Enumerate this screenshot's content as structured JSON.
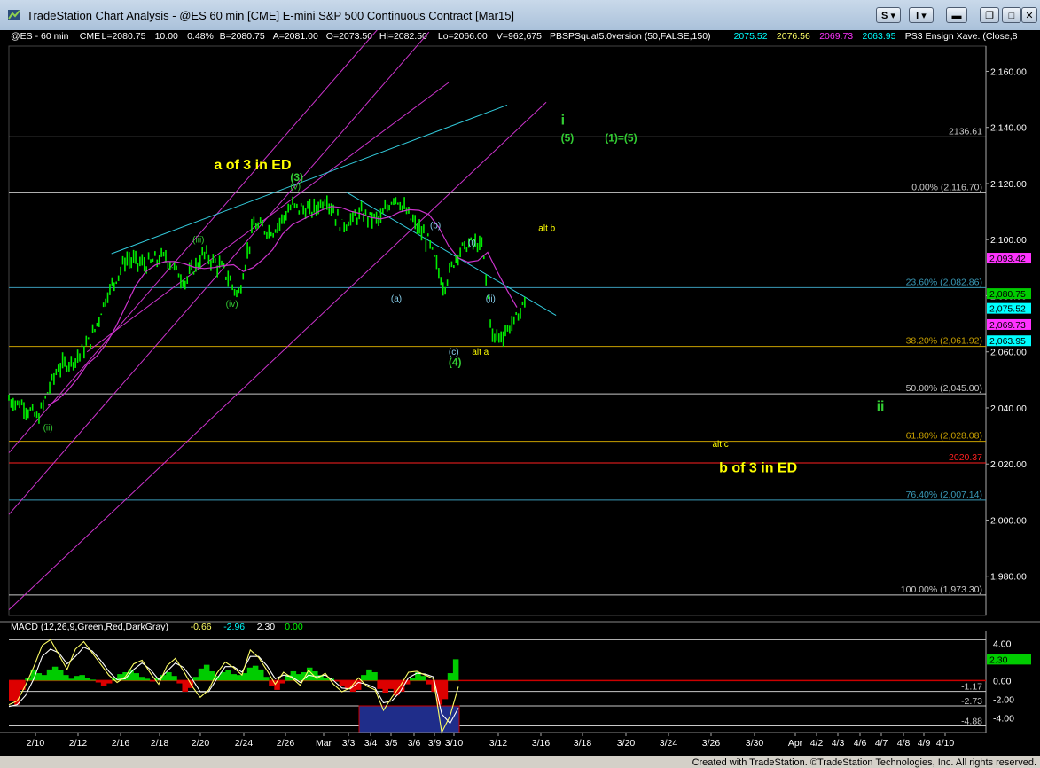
{
  "window": {
    "title": "TradeStation Chart Analysis - @ES 60 min [CME] E-mini S&P 500 Continuous Contract [Mar15]",
    "btn_s": "S",
    "btn_i": "I",
    "icons": [
      "minimize-small-icon",
      "restore-icon",
      "maximize-icon",
      "close-icon"
    ]
  },
  "footer": "Created with TradeStation. ©TradeStation Technologies, Inc. All rights reserved.",
  "chart_data": [
    {
      "type": "line",
      "subtype": "candlestick-price",
      "symbol_line": [
        {
          "text": "@ES - 60 min",
          "color": "#ffffff"
        },
        {
          "text": "CME",
          "color": "#ffffff"
        },
        {
          "text": "L=2080.75",
          "color": "#ffffff"
        },
        {
          "text": "10.00",
          "color": "#ffffff"
        },
        {
          "text": "0.48%",
          "color": "#ffffff"
        },
        {
          "text": "B=2080.75",
          "color": "#ffffff"
        },
        {
          "text": "A=2081.00",
          "color": "#ffffff"
        },
        {
          "text": "O=2073.50",
          "color": "#ffffff"
        },
        {
          "text": "Hi=2082.50",
          "color": "#ffffff"
        },
        {
          "text": "Lo=2066.00",
          "color": "#ffffff"
        },
        {
          "text": "V=962,675",
          "color": "#ffffff"
        },
        {
          "text": "PBSPSquat5.0version (50,FALSE,150)",
          "color": "#ffffff"
        },
        {
          "text": "2075.52",
          "color": "#00ffff"
        },
        {
          "text": "2076.56",
          "color": "#ffff66"
        },
        {
          "text": "2069.73",
          "color": "#ff33ff"
        },
        {
          "text": "2063.95",
          "color": "#00ffff"
        },
        {
          "text": "PS3 Ensign Xave. (Close,8",
          "color": "#ffffff"
        }
      ],
      "y_axis": {
        "ylim": [
          1966,
          2169
        ],
        "ticks": [
          "2,160.00",
          "2,140.00",
          "2,120.00",
          "2,100.00",
          "2,080.00",
          "2,060.00",
          "2,040.00",
          "2,020.00",
          "2,000.00",
          "1,980.00"
        ],
        "tick_values": [
          2160,
          2140,
          2120,
          2100,
          2080,
          2060,
          2040,
          2020,
          2000,
          1980
        ]
      },
      "x_axis": {
        "ticks": [
          "2/10",
          "2/12",
          "2/16",
          "2/18",
          "2/20",
          "2/24",
          "2/26",
          "Mar",
          "3/3",
          "3/4",
          "3/5",
          "3/6",
          "3/9",
          "3/10",
          "3/12",
          "3/16",
          "3/18",
          "3/20",
          "3/24",
          "3/26",
          "3/30",
          "Apr",
          "4/2",
          "4/3",
          "4/6",
          "4/7",
          "4/8",
          "4/9",
          "4/10"
        ]
      },
      "price_path": [
        [
          0,
          2043
        ],
        [
          0.015,
          2041
        ],
        [
          0.03,
          2036
        ],
        [
          0.04,
          2046
        ],
        [
          0.05,
          2054
        ],
        [
          0.07,
          2058
        ],
        [
          0.085,
          2065
        ],
        [
          0.1,
          2080
        ],
        [
          0.12,
          2093
        ],
        [
          0.14,
          2091
        ],
        [
          0.16,
          2094
        ],
        [
          0.18,
          2085
        ],
        [
          0.2,
          2095
        ],
        [
          0.22,
          2089
        ],
        [
          0.235,
          2080
        ],
        [
          0.25,
          2105
        ],
        [
          0.27,
          2103
        ],
        [
          0.29,
          2112
        ],
        [
          0.31,
          2110
        ],
        [
          0.325,
          2115
        ],
        [
          0.34,
          2105
        ],
        [
          0.36,
          2109
        ],
        [
          0.38,
          2107
        ],
        [
          0.395,
          2116
        ],
        [
          0.41,
          2108
        ],
        [
          0.43,
          2099
        ],
        [
          0.445,
          2083
        ],
        [
          0.46,
          2096
        ],
        [
          0.475,
          2099
        ],
        [
          0.485,
          2097
        ],
        [
          0.495,
          2065
        ],
        [
          0.505,
          2066
        ],
        [
          0.52,
          2072
        ],
        [
          0.53,
          2080
        ]
      ],
      "horizontal_levels": [
        {
          "value": 2136.61,
          "label": "2136.61",
          "color": "#c8c8c8"
        },
        {
          "value": 2116.7,
          "label": "0.00% (2,116.70)",
          "color": "#c8c8c8"
        },
        {
          "value": 2082.86,
          "label": "23.60% (2,082.86)",
          "color": "#3a9ab8"
        },
        {
          "value": 2061.92,
          "label": "38.20% (2,061.92)",
          "color": "#c8a000"
        },
        {
          "value": 2045.0,
          "label": "50.00% (2,045.00)",
          "color": "#c8c8c8"
        },
        {
          "value": 2028.08,
          "label": "61.80% (2,028.08)",
          "color": "#c8a000"
        },
        {
          "value": 2020.37,
          "label": "2020.37",
          "color": "#ff2020"
        },
        {
          "value": 2007.14,
          "label": "76.40% (2,007.14)",
          "color": "#3a9ab8"
        },
        {
          "value": 1973.3,
          "label": "100.00% (1,973.30)",
          "color": "#c8c8c8"
        }
      ],
      "right_markers": [
        {
          "value": 2093.42,
          "label": "2,093.42",
          "color": "#ff33ff"
        },
        {
          "value": 2080.75,
          "label": "2,080.75",
          "color": "#00cc00"
        },
        {
          "value": 2075.52,
          "label": "2,075.52",
          "color": "#00ffff"
        },
        {
          "value": 2069.73,
          "label": "2,069.73",
          "color": "#ff33ff"
        },
        {
          "value": 2063.95,
          "label": "2,063.95",
          "color": "#00ffff"
        }
      ],
      "annotations": [
        {
          "text": "i",
          "color": "#33cc33",
          "size": "big",
          "value": 2141,
          "xf": 0.565
        },
        {
          "text": "(5)",
          "color": "#33cc33",
          "size": "med",
          "value": 2135,
          "xf": 0.565
        },
        {
          "text": "(1)=(5)",
          "color": "#33cc33",
          "size": "med",
          "value": 2135,
          "xf": 0.61
        },
        {
          "text": "a of 3 in ED",
          "color": "#ffff00",
          "size": "big",
          "value": 2125,
          "xf": 0.21
        },
        {
          "text": "(3)",
          "color": "#33cc33",
          "size": "med",
          "value": 2121,
          "xf": 0.288
        },
        {
          "text": "(v)",
          "color": "#33cc33",
          "size": "small",
          "value": 2118,
          "xf": 0.288
        },
        {
          "text": "(b)",
          "color": "#87ceeb",
          "size": "small",
          "value": 2104,
          "xf": 0.431
        },
        {
          "text": "alt b",
          "color": "#ffff00",
          "size": "small",
          "value": 2103,
          "xf": 0.542
        },
        {
          "text": "(iii)",
          "color": "#33cc33",
          "size": "small",
          "value": 2099,
          "xf": 0.188
        },
        {
          "text": "(i)",
          "color": "#87ceeb",
          "size": "small",
          "value": 2098,
          "xf": 0.47
        },
        {
          "text": "(a)",
          "color": "#87ceeb",
          "size": "small",
          "value": 2078,
          "xf": 0.391
        },
        {
          "text": "(iv)",
          "color": "#33cc33",
          "size": "small",
          "value": 2076,
          "xf": 0.222
        },
        {
          "text": "(ii)",
          "color": "#87ceeb",
          "size": "small",
          "value": 2078,
          "xf": 0.488
        },
        {
          "text": "(c)",
          "color": "#87ceeb",
          "size": "small",
          "value": 2059,
          "xf": 0.45
        },
        {
          "text": "alt a",
          "color": "#ffff00",
          "size": "small",
          "value": 2059,
          "xf": 0.474
        },
        {
          "text": "(4)",
          "color": "#33cc33",
          "size": "med",
          "value": 2055,
          "xf": 0.45
        },
        {
          "text": "ii",
          "color": "#33cc33",
          "size": "big",
          "value": 2039,
          "xf": 0.888
        },
        {
          "text": "(ii)",
          "color": "#33cc33",
          "size": "small",
          "value": 2032,
          "xf": 0.035
        },
        {
          "text": "alt c",
          "color": "#ffff00",
          "size": "small",
          "value": 2026,
          "xf": 0.72
        },
        {
          "text": "b of 3 in ED",
          "color": "#ffff00",
          "size": "big",
          "value": 2017,
          "xf": 0.727
        }
      ]
    },
    {
      "type": "area",
      "subtype": "macd",
      "legend": [
        {
          "text": "MACD (12,26,9,Green,Red,DarkGray)",
          "color": "#ffffff"
        },
        {
          "text": "-0.66",
          "color": "#ffff66"
        },
        {
          "text": "-2.96",
          "color": "#00ffff"
        },
        {
          "text": "2.30",
          "color": "#ffffff"
        },
        {
          "text": "0.00",
          "color": "#00ff00"
        }
      ],
      "ylim": [
        -5.6,
        5.3
      ],
      "ticks": [
        "4.00",
        "0.00",
        "-2.00",
        "-4.00"
      ],
      "tick_values": [
        4,
        0,
        -2,
        -4
      ],
      "levels": [
        {
          "value": 4.4,
          "label": ""
        },
        {
          "value": -1.17,
          "label": "-1.17"
        },
        {
          "value": -2.73,
          "label": "-2.73"
        },
        {
          "value": -4.88,
          "label": "-4.88"
        }
      ],
      "current_marker": {
        "value": 2.3,
        "label": "2.30",
        "color": "#00cc00"
      },
      "histogram": [
        -2.2,
        -2.6,
        -1,
        0.3,
        1.2,
        0.8,
        0.6,
        1.2,
        1.5,
        1.1,
        0.6,
        0.2,
        0.5,
        0.6,
        0.3,
        0.1,
        -0.2,
        -0.6,
        -0.3,
        0.3,
        0.7,
        0.9,
        1.2,
        0.8,
        0.4,
        0.2,
        -0.1,
        0.3,
        0.6,
        0.9,
        0.5,
        -0.3,
        -1.2,
        -0.8,
        0.4,
        1.3,
        1.7,
        1.0,
        0.5,
        0.9,
        1.1,
        0.7,
        0.6,
        0.8,
        1.4,
        1.6,
        1.2,
        0.4,
        -0.6,
        -1.0,
        -0.3,
        0.6,
        1.0,
        0.7,
        0.9,
        1.4,
        1.0,
        0.6,
        0.3,
        0.2,
        -0.1,
        -0.6,
        -0.9,
        -1.2,
        -1.0,
        0.6,
        1.2,
        0.9,
        -0.9,
        -1.3,
        -0.9,
        -1.6,
        -1.2,
        -0.4,
        0.3,
        0.9,
        0.5,
        -0.4,
        -1.2,
        -2.6,
        -2.0,
        0.8,
        2.3
      ],
      "macd_line": [
        -2.6,
        -2.2,
        -0.5,
        1.5,
        3.8,
        4.4,
        2.8,
        1.2,
        3.4,
        4.2,
        3.0,
        1.8,
        0.6,
        -0.2,
        0.4,
        1.8,
        2.2,
        0.8,
        -0.4,
        1.6,
        2.4,
        1.0,
        -0.6,
        -1.8,
        -1.0,
        0.8,
        2.0,
        1.4,
        0.6,
        3.3,
        2.5,
        1.1,
        -0.4,
        0.9,
        0.3,
        -0.5,
        1.1,
        0.2,
        0.8,
        -0.4,
        -1.2,
        -0.8,
        0.3,
        -0.6,
        -1.0,
        -3.2,
        -1.8,
        -0.6,
        0.9,
        1.0,
        0.6,
        0.2,
        -5.6,
        -3.8,
        -0.66
      ],
      "signal_line": [
        -2.8,
        -2.6,
        -1.6,
        0.2,
        2.6,
        3.4,
        3.0,
        1.8,
        2.6,
        3.6,
        3.2,
        2.2,
        1.0,
        0.1,
        0.2,
        1.2,
        1.9,
        1.2,
        0.1,
        1.0,
        1.9,
        1.4,
        0.2,
        -1.2,
        -1.2,
        0.2,
        1.5,
        1.5,
        0.9,
        2.6,
        2.6,
        1.6,
        0.2,
        0.6,
        0.4,
        -0.2,
        0.6,
        0.4,
        0.6,
        0.0,
        -0.8,
        -0.9,
        -0.2,
        -0.4,
        -0.8,
        -2.4,
        -2.2,
        -1.2,
        0.3,
        0.8,
        0.7,
        0.4,
        -3.6,
        -4.6,
        -2.96
      ]
    }
  ]
}
